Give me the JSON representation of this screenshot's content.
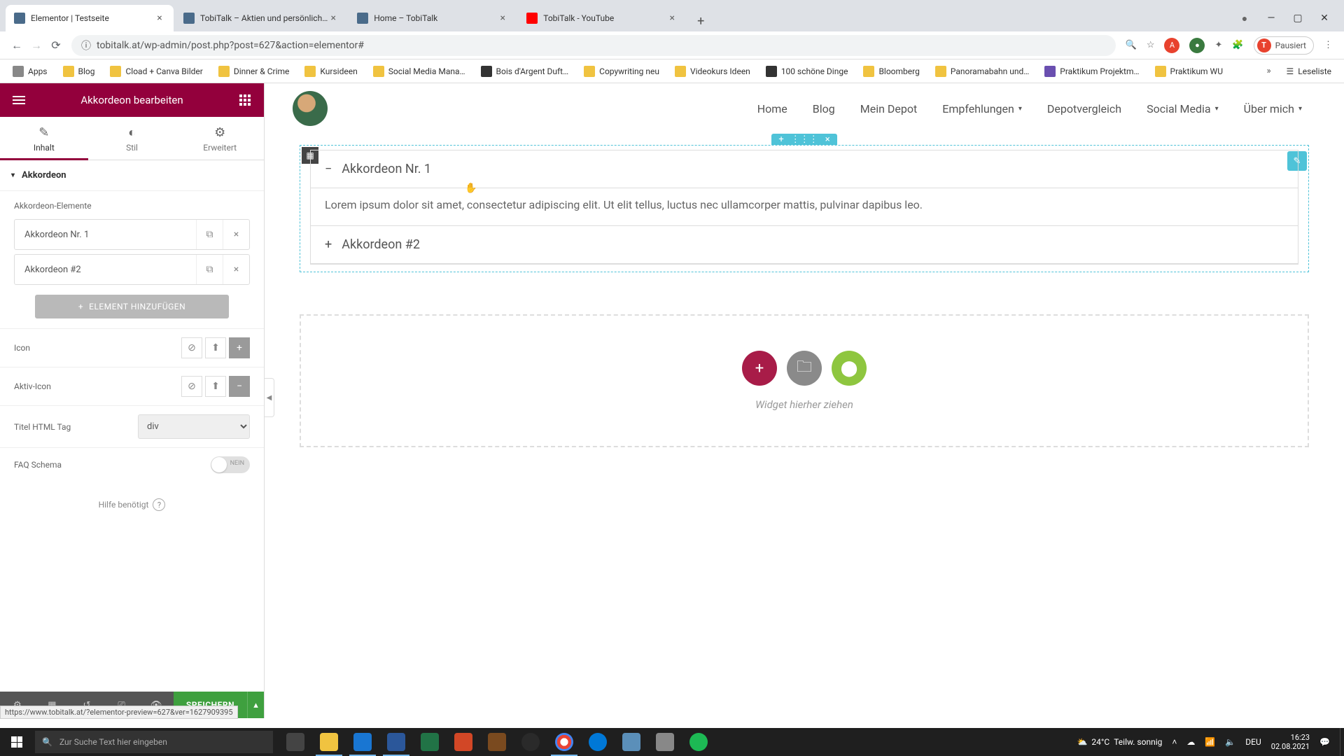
{
  "browser": {
    "tabs": [
      {
        "title": "Elementor | Testseite",
        "favicon": "#4a6b8a"
      },
      {
        "title": "TobiTalk – Aktien und persönlich…",
        "favicon": "#4a6b8a"
      },
      {
        "title": "Home – TobiTalk",
        "favicon": "#4a6b8a"
      },
      {
        "title": "TobiTalk - YouTube",
        "favicon": "#ff0000"
      }
    ],
    "url": "tobitalk.at/wp-admin/post.php?post=627&action=elementor#",
    "profile_label": "Pausiert",
    "bookmarks": [
      "Apps",
      "Blog",
      "Cload + Canva Bilder",
      "Dinner & Crime",
      "Kursideen",
      "Social Media Mana…",
      "Bois d'Argent Duft…",
      "Copywriting neu",
      "Videokurs Ideen",
      "100 schöne Dinge",
      "Bloomberg",
      "Panoramabahn und…",
      "Praktikum Projektm…",
      "Praktikum WU"
    ],
    "readlist": "Leseliste"
  },
  "sidebar": {
    "title": "Akkordeon bearbeiten",
    "tabs": {
      "content": "Inhalt",
      "style": "Stil",
      "advanced": "Erweitert"
    },
    "section": "Akkordeon",
    "items_label": "Akkordeon-Elemente",
    "items": [
      {
        "title": "Akkordeon Nr. 1"
      },
      {
        "title": "Akkordeon #2"
      }
    ],
    "add_button": "ELEMENT HINZUFÜGEN",
    "icon_label": "Icon",
    "active_icon_label": "Aktiv-Icon",
    "html_tag_label": "Titel HTML Tag",
    "html_tag_value": "div",
    "faq_label": "FAQ Schema",
    "faq_toggle": "NEIN",
    "help": "Hilfe benötigt",
    "save": "SPEICHERN"
  },
  "preview": {
    "nav": [
      "Home",
      "Blog",
      "Mein Depot",
      "Empfehlungen",
      "Depotvergleich",
      "Social Media",
      "Über mich"
    ],
    "nav_has_caret": [
      false,
      false,
      false,
      true,
      false,
      true,
      true
    ],
    "accordion": [
      {
        "title": "Akkordeon Nr. 1",
        "content": "Lorem ipsum dolor sit amet, consectetur adipiscing elit. Ut elit tellus, luctus nec ullamcorper mattis, pulvinar dapibus leo.",
        "open": true
      },
      {
        "title": "Akkordeon #2",
        "open": false
      }
    ],
    "drop_label": "Widget hierher ziehen"
  },
  "status_url": "https://www.tobitalk.at/?elementor-preview=627&ver=1627909395",
  "taskbar": {
    "search_placeholder": "Zur Suche Text hier eingeben",
    "weather_temp": "24°C",
    "weather_desc": "Teilw. sonnig",
    "lang": "DEU",
    "time": "16:23",
    "date": "02.08.2021"
  }
}
